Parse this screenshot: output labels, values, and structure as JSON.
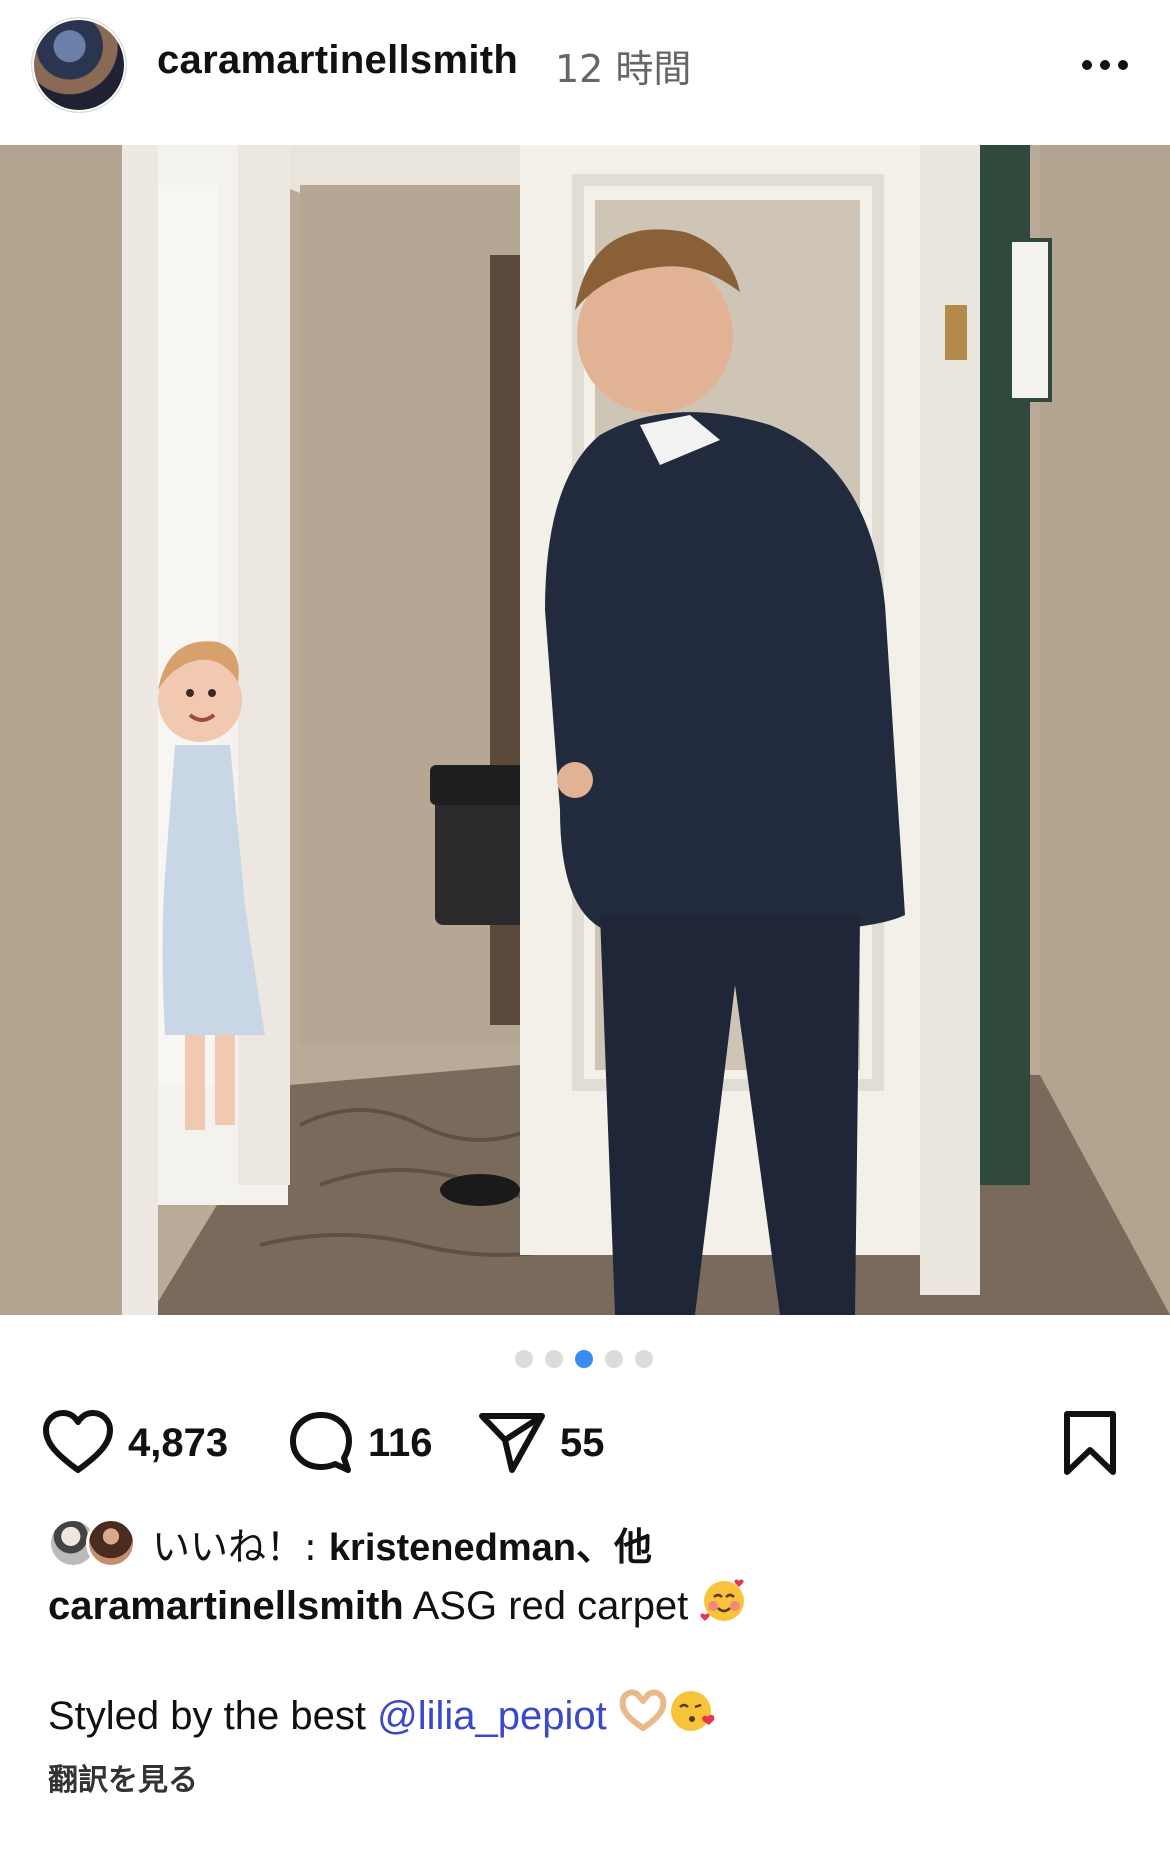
{
  "post": {
    "username": "caramartinellsmith",
    "time": "12 時間",
    "likes_count": "4,873",
    "comments_count": "116",
    "shares_count": "55",
    "carousel": {
      "total": 5,
      "active_index": 2
    },
    "liked_by_prefix": "いいね！: ",
    "liked_by_user": "kristenedman",
    "liked_by_suffix": "、他",
    "caption_user": "caramartinellsmith",
    "caption_text": " ASG red carpet ",
    "caption2_text": "Styled by the best ",
    "mention": "@lilia_pepiot",
    "translate_label": "翻訳を見る"
  },
  "icons": {
    "more": "more-horizontal-icon",
    "like": "heart-icon",
    "comment": "comment-bubble-icon",
    "share": "send-paper-plane-icon",
    "save": "bookmark-icon"
  },
  "colors": {
    "mention": "#3949c9",
    "active_dot": "#3a8df0"
  }
}
